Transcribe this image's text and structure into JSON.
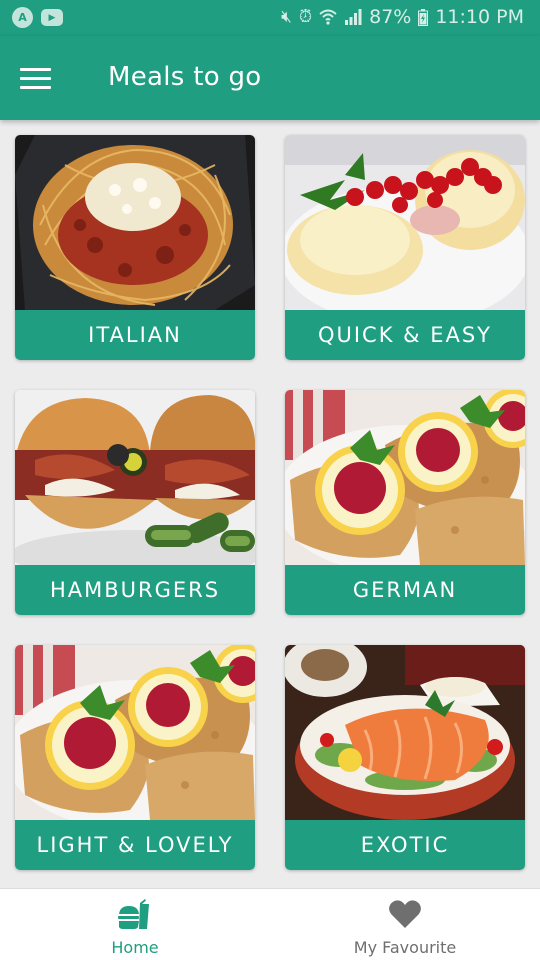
{
  "status_bar": {
    "battery": "87%",
    "time": "11:10 PM",
    "left_icons": [
      "android-auto-icon",
      "youtube-icon"
    ],
    "right_icons": [
      "mute-icon",
      "alarm-icon",
      "wifi-icon",
      "signal-icon",
      "battery-icon"
    ]
  },
  "app_bar": {
    "menu_icon": "hamburger-menu-icon",
    "title": "Meals to go"
  },
  "categories": [
    {
      "label": "ITALIAN",
      "photo": "spaghetti"
    },
    {
      "label": "QUICK & EASY",
      "photo": "toast-with-currants"
    },
    {
      "label": "HAMBURGERS",
      "photo": "burgers"
    },
    {
      "label": "GERMAN",
      "photo": "schnitzel"
    },
    {
      "label": "LIGHT & LOVELY",
      "photo": "schnitzel"
    },
    {
      "label": "EXOTIC",
      "photo": "salmon-salad"
    }
  ],
  "bottom_nav": {
    "items": [
      {
        "label": "Home",
        "icon": "burger-drink-icon",
        "active": true
      },
      {
        "label": "My Favourite",
        "icon": "heart-icon",
        "active": false
      }
    ]
  },
  "colors": {
    "primary": "#1f9e81",
    "background": "#ececec",
    "inactive": "#6f6f6f"
  }
}
